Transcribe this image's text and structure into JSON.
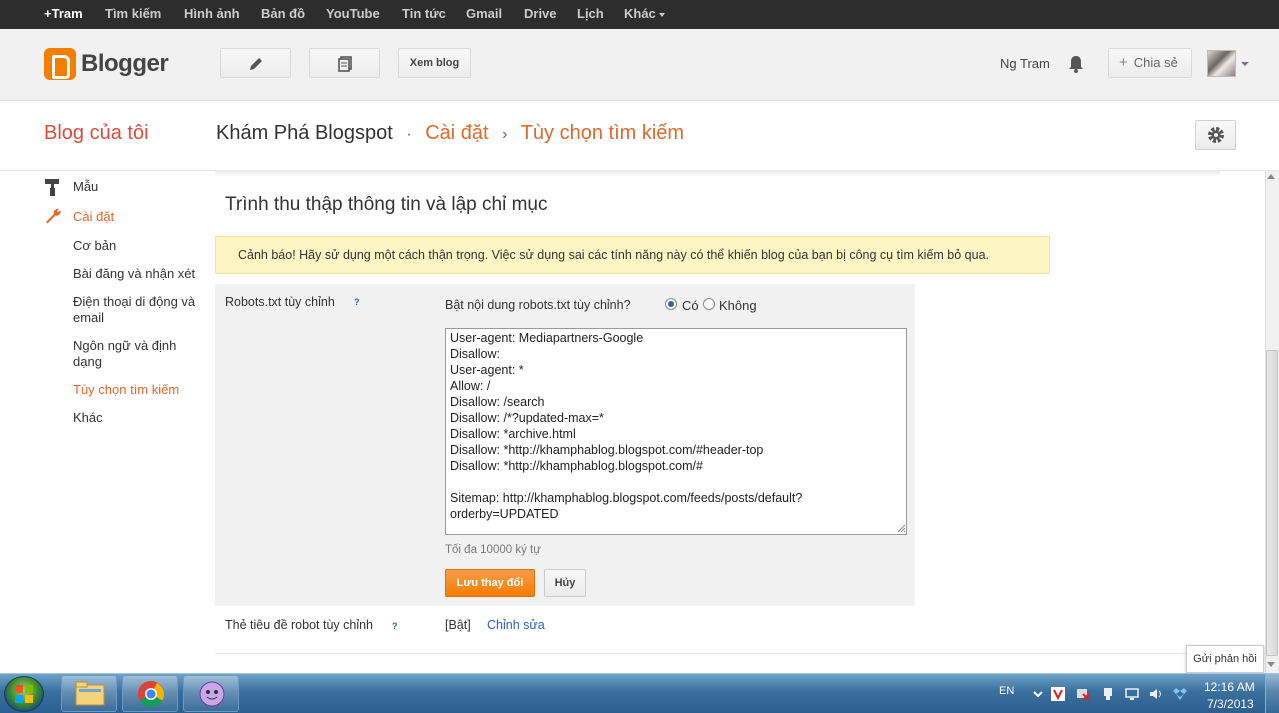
{
  "google_bar": {
    "links": [
      "+Tram",
      "Tìm kiếm",
      "Hình ảnh",
      "Bản đồ",
      "YouTube",
      "Tin tức",
      "Gmail",
      "Drive",
      "Lịch",
      "Khác"
    ]
  },
  "header": {
    "logo": "Blogger",
    "view_blog_button": "Xem blog",
    "user_name": "Ng Tram",
    "share_button": "Chia sẻ",
    "icons": [
      "pencil-icon",
      "posts-icon",
      "bell-icon",
      "avatar"
    ]
  },
  "title_row": {
    "my_blogs": "Blog của tôi",
    "blog_name": "Khám Phá Blogspot",
    "separator_dot": "·",
    "separator_chevron": "›",
    "settings": "Cài đặt",
    "current": "Tùy chọn tìm kiếm"
  },
  "sidebar": {
    "template": "Mẫu",
    "settings": "Cài đặt",
    "items": [
      "Cơ bản",
      "Bài đăng và nhận xét",
      "Điện thoại di động và email",
      "Ngôn ngữ và định dạng",
      "Tùy chọn tìm kiếm",
      "Khác"
    ]
  },
  "main": {
    "section_title": "Trình thu thập thông tin và lập chỉ mục",
    "warning": "Cảnh báo! Hãy sử dụng một cách thận trọng. Việc sử dụng sai các tính năng này có thể khiến blog của bạn bị công cụ tìm kiếm bỏ qua.",
    "robots": {
      "label": "Robots.txt tùy chỉnh",
      "help": "?",
      "enable_question": "Bật nội dung robots.txt tùy chỉnh?",
      "option_yes": "Có",
      "option_no": "Không",
      "selected": "Có",
      "content": "User-agent: Mediapartners-Google\nDisallow:\nUser-agent: *\nAllow: /\nDisallow: /search\nDisallow: /*?updated-max=*\nDisallow: *archive.html\nDisallow: *http://khamphablog.blogspot.com/#header-top\nDisallow: *http://khamphablog.blogspot.com/#\n\nSitemap: http://khamphablog.blogspot.com/feeds/posts/default?orderby=UPDATED",
      "max_chars": "Tối đa 10000 ký tự",
      "save": "Lưu thay đổi",
      "cancel": "Hủy"
    },
    "robot_tags": {
      "label": "Thẻ tiêu đề robot tùy chỉnh",
      "help": "?",
      "status": "[Bật]",
      "edit": "Chỉnh sửa"
    },
    "feedback": "Gửi phản hồi"
  },
  "taskbar": {
    "apps": [
      "explorer",
      "chrome",
      "yahoo-messenger"
    ],
    "lang": "EN",
    "time": "12:16 AM",
    "date": "7/3/2013"
  }
}
